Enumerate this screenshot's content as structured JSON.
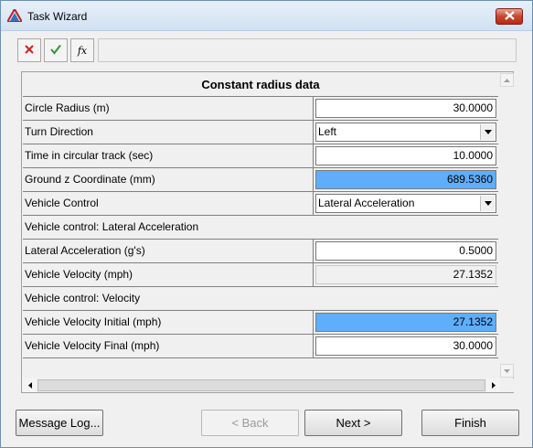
{
  "window": {
    "title": "Task Wizard",
    "app_icon": "app-logo-icon",
    "close_icon": "close-icon"
  },
  "toolbar": {
    "buttons": [
      {
        "name": "cancel-icon",
        "color": "#d42020"
      },
      {
        "name": "accept-icon",
        "color": "#2a9a2a"
      },
      {
        "name": "function-icon",
        "label": "fx"
      }
    ],
    "field_value": ""
  },
  "table": {
    "header": "Constant radius data",
    "rows": [
      {
        "label": "Circle Radius (m)",
        "value": "30.0000"
      },
      {
        "label": "Turn Direction",
        "value": "Left"
      },
      {
        "label": "Time in circular track (sec)",
        "value": "10.0000"
      },
      {
        "label": "Ground z Coordinate (mm)",
        "value": "689.5360"
      },
      {
        "label": "Vehicle Control",
        "value": "Lateral Acceleration"
      },
      {
        "label": "Vehicle control: Lateral Acceleration"
      },
      {
        "label": "Lateral Acceleration (g's)",
        "value": "0.5000"
      },
      {
        "label": "Vehicle Velocity (mph)",
        "value": "27.1352"
      },
      {
        "label": "Vehicle control: Velocity"
      },
      {
        "label": "Vehicle Velocity Initial (mph)",
        "value": "27.1352"
      },
      {
        "label": "Vehicle Velocity Final (mph)",
        "value": "30.0000"
      }
    ],
    "highlight_color": "#5eaefc"
  },
  "buttons": {
    "message_log": "Message Log...",
    "back": "< Back",
    "next": "Next >",
    "finish": "Finish"
  }
}
